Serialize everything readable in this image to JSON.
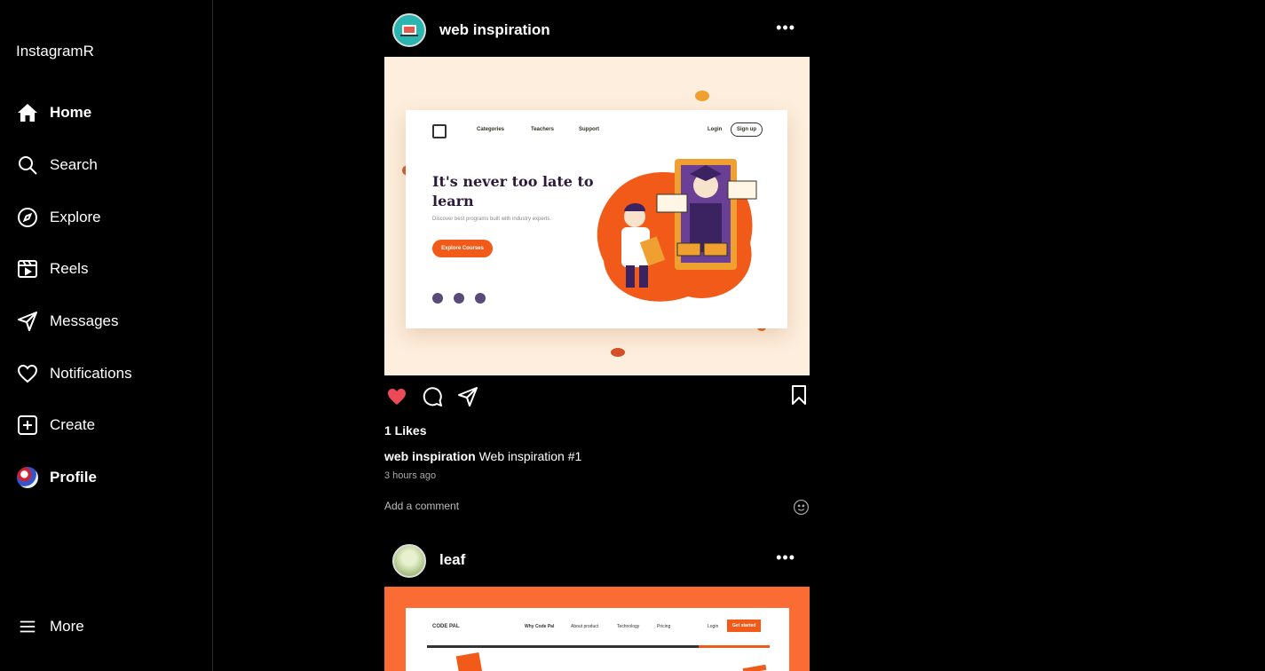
{
  "app": {
    "title": "InstagramR"
  },
  "nav": {
    "items": [
      {
        "label": "Home",
        "icon": "home-icon"
      },
      {
        "label": "Search",
        "icon": "search-icon"
      },
      {
        "label": "Explore",
        "icon": "compass-icon"
      },
      {
        "label": "Reels",
        "icon": "reels-icon"
      },
      {
        "label": "Messages",
        "icon": "send-icon"
      },
      {
        "label": "Notifications",
        "icon": "heart-icon"
      },
      {
        "label": "Create",
        "icon": "plus-square-icon"
      },
      {
        "label": "Profile",
        "icon": "avatar"
      }
    ],
    "more_label": "More"
  },
  "posts": [
    {
      "username": "web inspiration",
      "image": {
        "nav": [
          "Categories",
          "Teachers",
          "Support"
        ],
        "login": "Login",
        "signup": "Sign up",
        "headline": "It's never too late to learn",
        "subtext": "Discover best programs built with industry experts.",
        "cta": "Explore Courses"
      },
      "likes": "1 Likes",
      "caption_user": "web inspiration",
      "caption_text": "Web inspiration #1",
      "time": "3 hours ago",
      "comment_placeholder": "Add a comment",
      "liked": true
    },
    {
      "username": "leaf",
      "image": {
        "brand": "CODE PAL",
        "nav": [
          "Why Code Pal",
          "About product",
          "Technology",
          "Pricing"
        ],
        "login": "Login",
        "cta": "Get started"
      }
    }
  ],
  "colors": {
    "like": "#ed4956",
    "accent_orange": "#f25a1a",
    "post2_bg": "#fb6c35",
    "post1_bg": "#fdeedd"
  }
}
